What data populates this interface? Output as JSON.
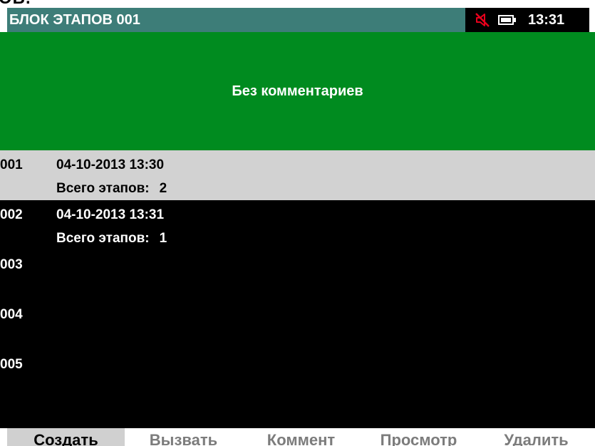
{
  "app": {
    "cropped_header_fragment": "ОВ.",
    "title": "БЛОК ЭТАПОВ 001",
    "time": "13:31",
    "status_icons": [
      "mute-icon",
      "battery-icon"
    ]
  },
  "banner": {
    "comment": "Без комментариев"
  },
  "blocks": [
    {
      "num": "001",
      "date": "04-10-2013 13:30",
      "stages_label": "Всего этапов:",
      "stages_count": "2",
      "selected": true
    },
    {
      "num": "002",
      "date": "04-10-2013 13:31",
      "stages_label": "Всего этапов:",
      "stages_count": "1",
      "selected": false
    },
    {
      "num": "003"
    },
    {
      "num": "004"
    },
    {
      "num": "005"
    }
  ],
  "softkeys": [
    {
      "label": "Создать",
      "active": true
    },
    {
      "label": "Вызвать",
      "active": false
    },
    {
      "label": "Коммент",
      "active": false
    },
    {
      "label": "Просмотр",
      "active": false
    },
    {
      "label": "Удалить",
      "active": false
    }
  ],
  "colors": {
    "titlebar": "#3d7d78",
    "banner": "#008b1f",
    "selected_row": "#d2d2d2",
    "mute_icon": "#e8001c",
    "inactive_softkey": "#7c7c7c"
  }
}
